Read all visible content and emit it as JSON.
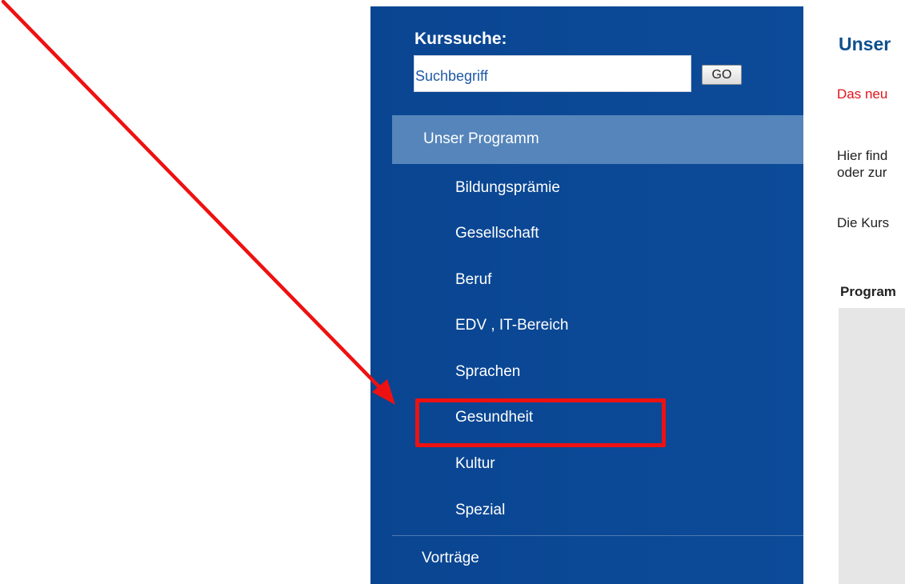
{
  "sidebar": {
    "search_heading": "Kurssuche:",
    "search_placeholder": "Suchbegriff",
    "go_label": "GO",
    "active_item": "Unser Programm",
    "subitems": [
      "Bildungsprämie",
      "Gesellschaft",
      "Beruf",
      "EDV , IT-Bereich",
      "Sprachen",
      "Gesundheit",
      "Kultur",
      "Spezial"
    ],
    "bottom_item": "Vorträge"
  },
  "main": {
    "title": "Unser",
    "news": "Das neu",
    "text_line1": "Hier find",
    "text_line2": "oder zur",
    "text_line3": "Die Kurs",
    "program_label": "Program"
  },
  "annotation": {
    "highlighted_item": "Gesundheit",
    "color": "#ee1111"
  },
  "colors": {
    "sidebar_bg": "#0a4591",
    "active_bg": "#5585bb",
    "title": "#0e4f8e",
    "news": "#e2131a"
  }
}
